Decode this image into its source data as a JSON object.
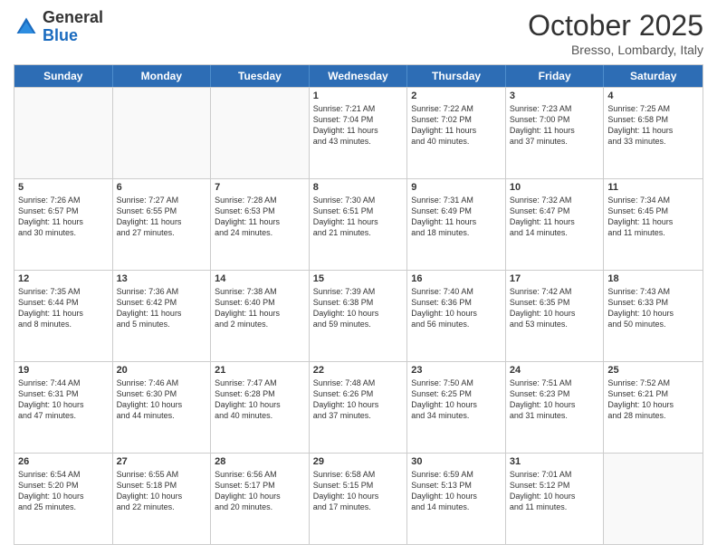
{
  "header": {
    "logo": {
      "general": "General",
      "blue": "Blue"
    },
    "title": "October 2025",
    "location": "Bresso, Lombardy, Italy"
  },
  "weekdays": [
    "Sunday",
    "Monday",
    "Tuesday",
    "Wednesday",
    "Thursday",
    "Friday",
    "Saturday"
  ],
  "rows": [
    [
      {
        "day": "",
        "info": ""
      },
      {
        "day": "",
        "info": ""
      },
      {
        "day": "",
        "info": ""
      },
      {
        "day": "1",
        "info": "Sunrise: 7:21 AM\nSunset: 7:04 PM\nDaylight: 11 hours\nand 43 minutes."
      },
      {
        "day": "2",
        "info": "Sunrise: 7:22 AM\nSunset: 7:02 PM\nDaylight: 11 hours\nand 40 minutes."
      },
      {
        "day": "3",
        "info": "Sunrise: 7:23 AM\nSunset: 7:00 PM\nDaylight: 11 hours\nand 37 minutes."
      },
      {
        "day": "4",
        "info": "Sunrise: 7:25 AM\nSunset: 6:58 PM\nDaylight: 11 hours\nand 33 minutes."
      }
    ],
    [
      {
        "day": "5",
        "info": "Sunrise: 7:26 AM\nSunset: 6:57 PM\nDaylight: 11 hours\nand 30 minutes."
      },
      {
        "day": "6",
        "info": "Sunrise: 7:27 AM\nSunset: 6:55 PM\nDaylight: 11 hours\nand 27 minutes."
      },
      {
        "day": "7",
        "info": "Sunrise: 7:28 AM\nSunset: 6:53 PM\nDaylight: 11 hours\nand 24 minutes."
      },
      {
        "day": "8",
        "info": "Sunrise: 7:30 AM\nSunset: 6:51 PM\nDaylight: 11 hours\nand 21 minutes."
      },
      {
        "day": "9",
        "info": "Sunrise: 7:31 AM\nSunset: 6:49 PM\nDaylight: 11 hours\nand 18 minutes."
      },
      {
        "day": "10",
        "info": "Sunrise: 7:32 AM\nSunset: 6:47 PM\nDaylight: 11 hours\nand 14 minutes."
      },
      {
        "day": "11",
        "info": "Sunrise: 7:34 AM\nSunset: 6:45 PM\nDaylight: 11 hours\nand 11 minutes."
      }
    ],
    [
      {
        "day": "12",
        "info": "Sunrise: 7:35 AM\nSunset: 6:44 PM\nDaylight: 11 hours\nand 8 minutes."
      },
      {
        "day": "13",
        "info": "Sunrise: 7:36 AM\nSunset: 6:42 PM\nDaylight: 11 hours\nand 5 minutes."
      },
      {
        "day": "14",
        "info": "Sunrise: 7:38 AM\nSunset: 6:40 PM\nDaylight: 11 hours\nand 2 minutes."
      },
      {
        "day": "15",
        "info": "Sunrise: 7:39 AM\nSunset: 6:38 PM\nDaylight: 10 hours\nand 59 minutes."
      },
      {
        "day": "16",
        "info": "Sunrise: 7:40 AM\nSunset: 6:36 PM\nDaylight: 10 hours\nand 56 minutes."
      },
      {
        "day": "17",
        "info": "Sunrise: 7:42 AM\nSunset: 6:35 PM\nDaylight: 10 hours\nand 53 minutes."
      },
      {
        "day": "18",
        "info": "Sunrise: 7:43 AM\nSunset: 6:33 PM\nDaylight: 10 hours\nand 50 minutes."
      }
    ],
    [
      {
        "day": "19",
        "info": "Sunrise: 7:44 AM\nSunset: 6:31 PM\nDaylight: 10 hours\nand 47 minutes."
      },
      {
        "day": "20",
        "info": "Sunrise: 7:46 AM\nSunset: 6:30 PM\nDaylight: 10 hours\nand 44 minutes."
      },
      {
        "day": "21",
        "info": "Sunrise: 7:47 AM\nSunset: 6:28 PM\nDaylight: 10 hours\nand 40 minutes."
      },
      {
        "day": "22",
        "info": "Sunrise: 7:48 AM\nSunset: 6:26 PM\nDaylight: 10 hours\nand 37 minutes."
      },
      {
        "day": "23",
        "info": "Sunrise: 7:50 AM\nSunset: 6:25 PM\nDaylight: 10 hours\nand 34 minutes."
      },
      {
        "day": "24",
        "info": "Sunrise: 7:51 AM\nSunset: 6:23 PM\nDaylight: 10 hours\nand 31 minutes."
      },
      {
        "day": "25",
        "info": "Sunrise: 7:52 AM\nSunset: 6:21 PM\nDaylight: 10 hours\nand 28 minutes."
      }
    ],
    [
      {
        "day": "26",
        "info": "Sunrise: 6:54 AM\nSunset: 5:20 PM\nDaylight: 10 hours\nand 25 minutes."
      },
      {
        "day": "27",
        "info": "Sunrise: 6:55 AM\nSunset: 5:18 PM\nDaylight: 10 hours\nand 22 minutes."
      },
      {
        "day": "28",
        "info": "Sunrise: 6:56 AM\nSunset: 5:17 PM\nDaylight: 10 hours\nand 20 minutes."
      },
      {
        "day": "29",
        "info": "Sunrise: 6:58 AM\nSunset: 5:15 PM\nDaylight: 10 hours\nand 17 minutes."
      },
      {
        "day": "30",
        "info": "Sunrise: 6:59 AM\nSunset: 5:13 PM\nDaylight: 10 hours\nand 14 minutes."
      },
      {
        "day": "31",
        "info": "Sunrise: 7:01 AM\nSunset: 5:12 PM\nDaylight: 10 hours\nand 11 minutes."
      },
      {
        "day": "",
        "info": ""
      }
    ]
  ]
}
